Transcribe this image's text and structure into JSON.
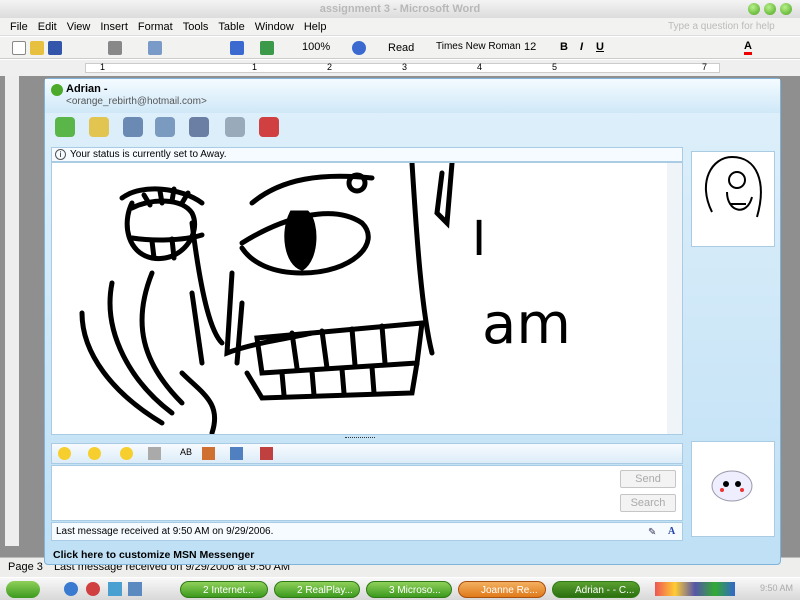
{
  "word": {
    "title": "assignment 3 - Microsoft Word",
    "menu": [
      "File",
      "Edit",
      "View",
      "Insert",
      "Format",
      "Tools",
      "Table",
      "Window",
      "Help"
    ],
    "help_placeholder": "Type a question for help",
    "zoom": "100%",
    "read": "Read",
    "font": "Times New Roman",
    "size": "12",
    "ruler_marks": [
      "1",
      "1",
      "2",
      "3",
      "4",
      "5",
      "7"
    ],
    "status_page": "Page 3",
    "status_msg": "Last message received on 9/29/2006 at 9:50 AM"
  },
  "msn": {
    "contact_name": "Adrian -",
    "contact_email": "<orange_rebirth@hotmail.com>",
    "status_notice": "Your status is currently set to Away.",
    "drawing_text": [
      "I",
      "am"
    ],
    "send": "Send",
    "search": "Search",
    "last_message": "Last message received at 9:50 AM on 9/29/2006.",
    "customize": "Click here to customize MSN Messenger"
  },
  "taskbar": {
    "tasks": [
      "2 Internet...",
      "2 RealPlay...",
      "3 Microso...",
      "Joanne Re...",
      "Adrian - - C..."
    ],
    "clock": "9:50 AM",
    "colors": {
      "green": "#3c9a1e",
      "orange": "#e07a1a"
    }
  }
}
